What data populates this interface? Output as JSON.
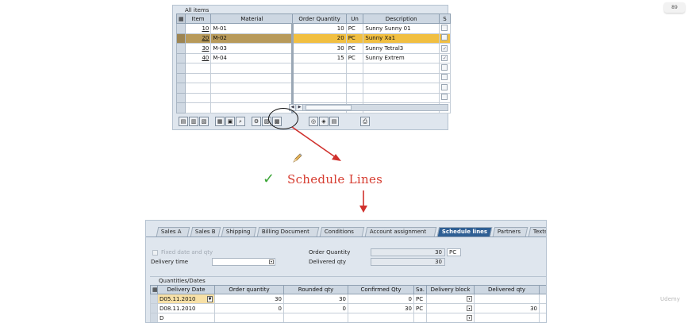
{
  "top_panel": {
    "title": "All items",
    "columns": [
      "Item",
      "Material",
      "Order Quantity",
      "Un",
      "Description",
      "S"
    ],
    "rows": [
      {
        "item": "10",
        "material": "M-01",
        "qty": "10",
        "unit": "PC",
        "desc": "Sunny Sunny 01",
        "checked": false
      },
      {
        "item": "20",
        "material": "M-02",
        "qty": "20",
        "unit": "PC",
        "desc": "Sunny Xa1",
        "checked": false
      },
      {
        "item": "30",
        "material": "M-03",
        "qty": "30",
        "unit": "PC",
        "desc": "Sunny Tetral3",
        "checked": true
      },
      {
        "item": "40",
        "material": "M-04",
        "qty": "15",
        "unit": "PC",
        "desc": "Sunny Extrem",
        "checked": true
      }
    ],
    "highlighted_row": 1,
    "empty_rows": 5
  },
  "heading": "Schedule Lines",
  "bottom_panel": {
    "tabs": [
      {
        "label": "Sales A",
        "active": false
      },
      {
        "label": "Sales B",
        "active": false
      },
      {
        "label": "Shipping",
        "active": false
      },
      {
        "label": "Billing Document",
        "active": false
      },
      {
        "label": "Conditions",
        "active": false
      },
      {
        "label": "Account assignment",
        "active": false
      },
      {
        "label": "Schedule lines",
        "active": true
      },
      {
        "label": "Partners",
        "active": false
      },
      {
        "label": "Texts",
        "active": false
      }
    ],
    "fixed_date_label": "Fixed date and qty",
    "delivery_time_label": "Delivery time",
    "order_quantity_label": "Order Quantity",
    "order_quantity_value": "30",
    "order_quantity_unit": "PC",
    "delivered_qty_label": "Delivered qty",
    "delivered_qty_value": "30",
    "subsection_title": "Quantities/Dates",
    "columns": [
      "Delivery Date",
      "Order quantity",
      "Rounded qty",
      "Confirmed Qty",
      "Sa.",
      "Delivery block",
      "Delivered qty"
    ],
    "rows": [
      {
        "prefix": "D",
        "date": "05.11.2010",
        "order_qty": "30",
        "rounded_qty": "30",
        "confirmed_qty": "0",
        "unit": "PC",
        "delivered_qty": ""
      },
      {
        "prefix": "D",
        "date": "08.11.2010",
        "order_qty": "0",
        "rounded_qty": "0",
        "confirmed_qty": "30",
        "unit": "PC",
        "delivered_qty": "30"
      },
      {
        "prefix": "D",
        "date": "",
        "order_qty": "",
        "rounded_qty": "",
        "confirmed_qty": "",
        "unit": "",
        "delivered_qty": ""
      }
    ]
  },
  "corner_badge": "89",
  "watermark": "Udemy",
  "colors": {
    "heading": "#d63b2f",
    "check": "#3aa535",
    "arrow": "#d0312d",
    "active_tab": "#2f5f94",
    "highlight_row": "#f1bf41"
  }
}
